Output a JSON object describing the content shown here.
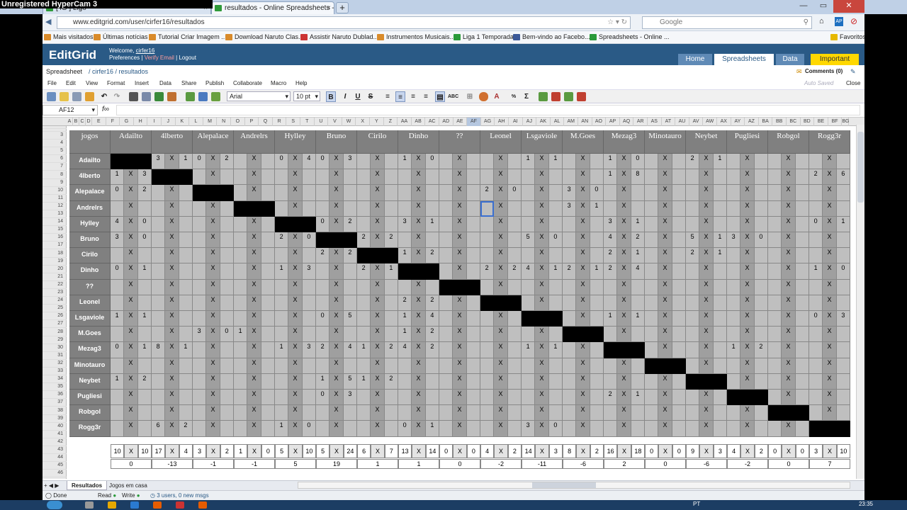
{
  "recorder": "Unregistered HyperCam 3",
  "browser": {
    "tabs": [
      {
        "label": "[ iG ] Ligo"
      },
      {
        "label": "resultados - Online Spreadsheets - Ed..."
      }
    ],
    "url": "www.editgrid.com/user/cirfer16/resultados",
    "search_placeholder": "Google",
    "bookmarks": [
      "Mais visitados",
      "Últimas notícias",
      "Tutorial Criar Imagem ...",
      "Download Naruto Clas...",
      "Assistir Naruto Dublad...",
      "Instrumentos Musicais...",
      "Liga 1 Temporada",
      "Bem-vindo ao Facebo...",
      "Spreadsheets - Online ..."
    ],
    "favorites": "Favoritos"
  },
  "app": {
    "logo": "EditGrid",
    "welcome": "Welcome,",
    "user": "cirfer16",
    "preferences": "Preferences",
    "verify": "Verify Email",
    "logout": "Logout",
    "sep": "|",
    "nav": [
      "Home",
      "Spreadsheets",
      "Data",
      "Important"
    ],
    "crumb_root": "Spreadsheet",
    "crumb_path": "/ cirfer16 / resultados",
    "comments": "Comments (0)",
    "autosaved": "Auto Saved",
    "close": "Close",
    "menu": [
      "File",
      "Edit",
      "View",
      "Format",
      "Insert",
      "Data",
      "Share",
      "Publish",
      "Collaborate",
      "Macro",
      "Help"
    ],
    "font": "Arial",
    "font_size": "10 pt",
    "cell_ref": "AF12",
    "fx": "f∞",
    "sheet_tabs": [
      "Resultados",
      "Jogos em casa"
    ],
    "status": {
      "done": "Done",
      "read": "Read",
      "write": "Write",
      "users": "3 users, 0 new msgs"
    },
    "taskbar": {
      "lang": "PT",
      "time": "23:35"
    }
  },
  "columns": [
    "A",
    "B",
    "C",
    "D",
    "E",
    "F",
    "G",
    "H",
    "I",
    "J",
    "K",
    "L",
    "M",
    "N",
    "O",
    "P",
    "Q",
    "R",
    "S",
    "T",
    "U",
    "V",
    "W",
    "X",
    "Y",
    "Z",
    "AA",
    "AB",
    "AC",
    "AD",
    "AE",
    "AF",
    "AG",
    "AH",
    "AI",
    "AJ",
    "AK",
    "AL",
    "AM",
    "AN",
    "AO",
    "AP",
    "AQ",
    "AR",
    "AS",
    "AT",
    "AU",
    "AV",
    "AW",
    "AX",
    "AY",
    "AZ",
    "BA",
    "BB",
    "BC",
    "BD",
    "BE",
    "BF",
    "BG"
  ],
  "corner_label": "jogos",
  "teams": [
    "Adailto",
    "4lberto",
    "Alepalace",
    "Andrelrs",
    "Hylley",
    "Bruno",
    "Cirilo",
    "Dinho",
    "??",
    "Leonel",
    "Lsgaviole",
    "M.Goes",
    "Mezag3",
    "Minotauro",
    "Neybet",
    "Pugliesi",
    "Robgol",
    "Rogg3r"
  ],
  "results": [
    [
      null,
      [
        3,
        1
      ],
      [
        0,
        2
      ],
      null,
      [
        0,
        4
      ],
      [
        0,
        3
      ],
      null,
      [
        1,
        0
      ],
      null,
      null,
      [
        1,
        1
      ],
      null,
      [
        1,
        0
      ],
      null,
      [
        2,
        1
      ],
      null,
      null,
      null
    ],
    [
      [
        1,
        3
      ],
      null,
      null,
      null,
      null,
      null,
      null,
      null,
      null,
      null,
      null,
      null,
      [
        1,
        8
      ],
      null,
      null,
      null,
      null,
      [
        2,
        6
      ]
    ],
    [
      [
        0,
        2
      ],
      null,
      null,
      null,
      null,
      null,
      null,
      null,
      null,
      [
        2,
        0
      ],
      null,
      [
        3,
        0
      ],
      null,
      null,
      null,
      null,
      null,
      null
    ],
    [
      null,
      null,
      null,
      null,
      null,
      null,
      null,
      null,
      null,
      null,
      null,
      [
        3,
        1
      ],
      null,
      null,
      null,
      null,
      null,
      null
    ],
    [
      [
        4,
        0
      ],
      null,
      null,
      null,
      null,
      [
        0,
        2
      ],
      null,
      [
        3,
        1
      ],
      null,
      null,
      null,
      null,
      [
        3,
        1
      ],
      null,
      null,
      null,
      null,
      [
        0,
        1
      ]
    ],
    [
      [
        3,
        0
      ],
      null,
      null,
      null,
      [
        2,
        0
      ],
      null,
      [
        2,
        2
      ],
      null,
      null,
      null,
      [
        5,
        0
      ],
      null,
      [
        4,
        2
      ],
      null,
      [
        5,
        1
      ],
      [
        3,
        0
      ],
      null,
      null
    ],
    [
      null,
      null,
      null,
      null,
      null,
      [
        2,
        2
      ],
      null,
      [
        1,
        2
      ],
      null,
      null,
      null,
      null,
      [
        2,
        1
      ],
      null,
      [
        2,
        1
      ],
      null,
      null,
      null
    ],
    [
      [
        0,
        1
      ],
      null,
      null,
      null,
      [
        1,
        3
      ],
      null,
      [
        2,
        1
      ],
      null,
      null,
      [
        2,
        2
      ],
      [
        4,
        1
      ],
      [
        2,
        1
      ],
      [
        2,
        4
      ],
      null,
      null,
      null,
      null,
      [
        1,
        0
      ]
    ],
    [
      null,
      null,
      null,
      null,
      null,
      null,
      null,
      null,
      null,
      null,
      null,
      null,
      null,
      null,
      null,
      null,
      null,
      null
    ],
    [
      null,
      null,
      null,
      null,
      null,
      null,
      null,
      [
        2,
        2
      ],
      null,
      null,
      null,
      null,
      null,
      null,
      null,
      null,
      null,
      null
    ],
    [
      [
        1,
        1
      ],
      null,
      null,
      null,
      null,
      [
        0,
        5
      ],
      null,
      [
        1,
        4
      ],
      null,
      null,
      null,
      null,
      [
        1,
        1
      ],
      null,
      null,
      null,
      null,
      [
        0,
        3
      ]
    ],
    [
      null,
      null,
      [
        3,
        0
      ],
      [
        1,
        null
      ],
      null,
      null,
      null,
      [
        1,
        2
      ],
      null,
      null,
      null,
      null,
      null,
      null,
      null,
      null,
      null,
      null
    ],
    [
      [
        0,
        1
      ],
      [
        8,
        1
      ],
      null,
      null,
      [
        1,
        3
      ],
      [
        2,
        4
      ],
      [
        1,
        2
      ],
      [
        4,
        2
      ],
      null,
      null,
      [
        1,
        1
      ],
      null,
      null,
      null,
      null,
      [
        1,
        2
      ],
      null,
      null
    ],
    [
      null,
      null,
      null,
      null,
      null,
      null,
      null,
      null,
      null,
      null,
      null,
      null,
      null,
      null,
      null,
      null,
      null,
      null
    ],
    [
      [
        1,
        2
      ],
      null,
      null,
      null,
      null,
      [
        1,
        5
      ],
      [
        1,
        2
      ],
      null,
      null,
      null,
      null,
      null,
      null,
      null,
      null,
      null,
      null,
      null
    ],
    [
      null,
      null,
      null,
      null,
      null,
      [
        0,
        3
      ],
      null,
      null,
      null,
      null,
      null,
      null,
      [
        2,
        1
      ],
      null,
      null,
      null,
      null,
      null
    ],
    [
      null,
      null,
      null,
      null,
      null,
      null,
      null,
      null,
      null,
      null,
      null,
      null,
      null,
      null,
      null,
      null,
      null,
      null
    ],
    [
      null,
      [
        6,
        2
      ],
      null,
      null,
      [
        1,
        0
      ],
      null,
      null,
      [
        0,
        1
      ],
      null,
      null,
      [
        3,
        0
      ],
      null,
      null,
      null,
      null,
      null,
      null,
      null
    ]
  ],
  "totals": [
    [
      10,
      10
    ],
    [
      17,
      4
    ],
    [
      3,
      2
    ],
    [
      1,
      0
    ],
    [
      5,
      10
    ],
    [
      5,
      24
    ],
    [
      6,
      7
    ],
    [
      13,
      14
    ],
    [
      0,
      0
    ],
    [
      4,
      2
    ],
    [
      14,
      3
    ],
    [
      8,
      2
    ],
    [
      16,
      18
    ],
    [
      0,
      0
    ],
    [
      9,
      3
    ],
    [
      4,
      2
    ],
    [
      0,
      0
    ],
    [
      3,
      10
    ]
  ],
  "differences": [
    "0",
    "-13",
    "-1",
    "-1",
    "5",
    "19",
    "1",
    "1",
    "0",
    "-2",
    "-11",
    "-6",
    "2",
    "0",
    "-6",
    "-2",
    "0",
    "7"
  ],
  "x_mark": "X"
}
